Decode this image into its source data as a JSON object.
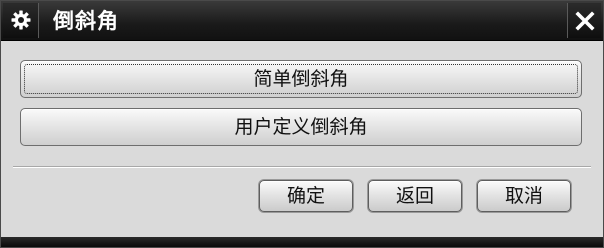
{
  "window": {
    "title": "倒斜角"
  },
  "options": {
    "simple_chamfer": "简单倒斜角",
    "user_defined_chamfer": "用户定义倒斜角"
  },
  "footer": {
    "ok": "确定",
    "back": "返回",
    "cancel": "取消"
  },
  "icons": {
    "title_icon": "gear-icon",
    "close_icon": "close-icon"
  }
}
